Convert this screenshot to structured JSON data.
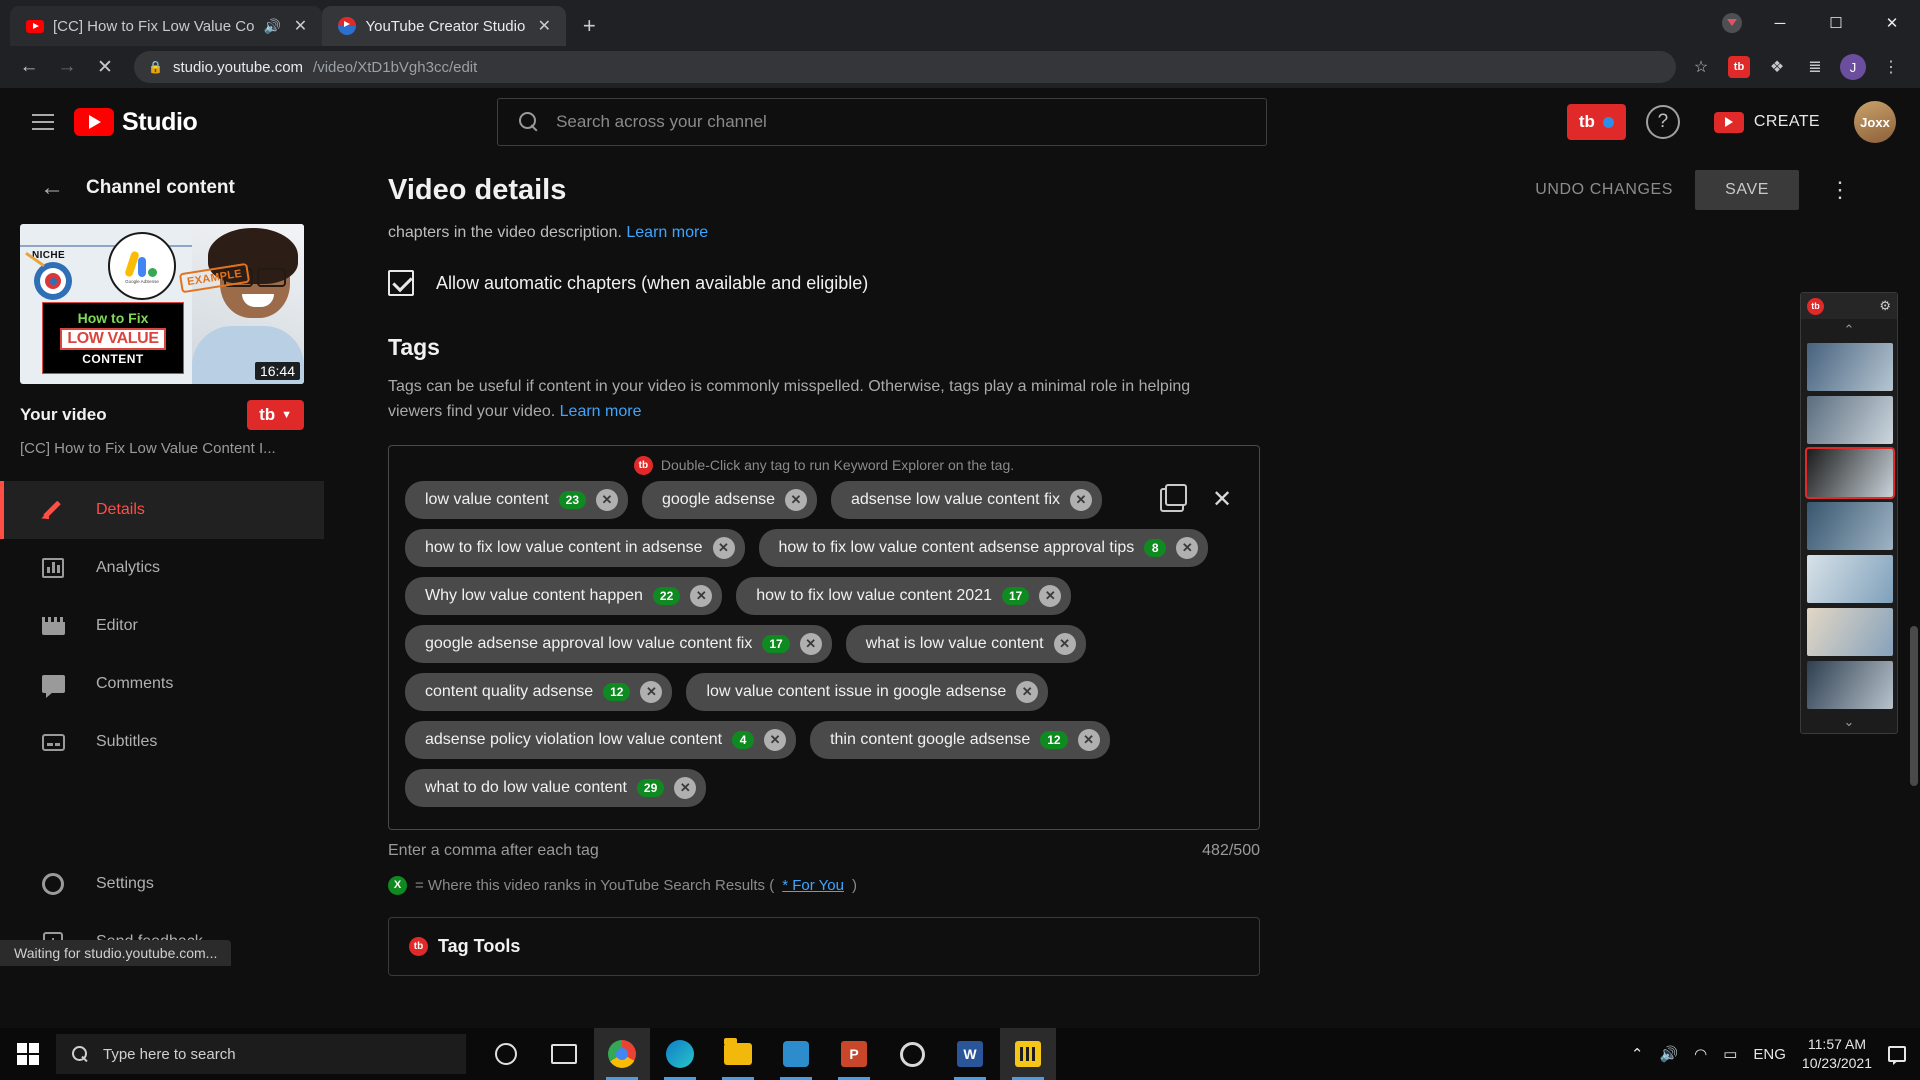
{
  "browser": {
    "tabs": [
      {
        "title": "[CC] How to Fix Low Value Co",
        "favicon": "youtube-icon",
        "muted": true,
        "active": false
      },
      {
        "title": "YouTube Creator Studio",
        "favicon": "tubebuddy-icon",
        "muted": false,
        "active": true
      }
    ],
    "newtab_label": "+",
    "url_domain": "studio.youtube.com",
    "url_path": "/video/XtD1bVgh3cc/edit",
    "back_label": "←",
    "forward_label": "→",
    "stop_label": "✕",
    "star_label": "☆",
    "tubebuddy_label": "tb",
    "extensions_label": "❖",
    "readinglist_label": "≣",
    "profile_initial": "J",
    "menu_label": "⋮",
    "minimize_label": "─",
    "maximize_label": "☐",
    "close_label": "✕"
  },
  "studio": {
    "logo_text": "Studio",
    "search_placeholder": "Search across your channel",
    "search_value": "",
    "tubebuddy_badge": "tb",
    "help_label": "?",
    "create_label": "CREATE",
    "avatar_initials": "Joxx"
  },
  "sidebar": {
    "back_label": "←",
    "title": "Channel content",
    "thumbnail": {
      "niche_label": "NICHE",
      "adsense_label": "Google AdSense",
      "example_stamp": "EXAMPLE",
      "line1": "How to Fix",
      "line2": "LOW VALUE",
      "line3": "CONTENT",
      "duration": "16:44"
    },
    "your_video_label": "Your video",
    "tubebuddy_pill": "tb",
    "video_title": "[CC] How to Fix Low Value Content I...",
    "items": [
      {
        "label": "Details",
        "icon": "pencil-icon",
        "active": true
      },
      {
        "label": "Analytics",
        "icon": "bar-chart-icon",
        "active": false
      },
      {
        "label": "Editor",
        "icon": "film-icon",
        "active": false
      },
      {
        "label": "Comments",
        "icon": "comment-icon",
        "active": false
      },
      {
        "label": "Subtitles",
        "icon": "subtitles-icon",
        "active": false
      }
    ],
    "bottom_items": [
      {
        "label": "Settings",
        "icon": "gear-icon"
      },
      {
        "label": "Send feedback",
        "icon": "feedback-icon"
      }
    ]
  },
  "main": {
    "page_title": "Video details",
    "undo_label": "UNDO CHANGES",
    "save_label": "SAVE",
    "more_label": "⋮",
    "chapters_cut_text": "chapters in the video description.",
    "chapters_learn_more": "Learn more",
    "auto_chapters_label": "Allow automatic chapters (when available and eligible)",
    "auto_chapters_checked": true,
    "tags_heading": "Tags",
    "tags_description": "Tags can be useful if content in your video is commonly misspelled. Otherwise, tags play a minimal role in helping viewers find your video.",
    "tags_learn_more": "Learn more",
    "tagbox_hint": "Double-Click any tag to run Keyword Explorer on the tag.",
    "tagbox_hint_badge": "tb",
    "copy_icon_label": "copy",
    "close_icon_label": "✕",
    "tags": [
      {
        "label": "low value content",
        "count": "23"
      },
      {
        "label": "google adsense",
        "count": null
      },
      {
        "label": "adsense low value content fix",
        "count": null
      },
      {
        "label": "how to fix low value content in adsense",
        "count": null
      },
      {
        "label": "how to fix low value content adsense approval tips",
        "count": "8"
      },
      {
        "label": "Why low value content happen",
        "count": "22"
      },
      {
        "label": "how to fix low value content 2021",
        "count": "17"
      },
      {
        "label": "google adsense approval low value content fix",
        "count": "17"
      },
      {
        "label": "what is low value content",
        "count": null
      },
      {
        "label": "content quality adsense",
        "count": "12"
      },
      {
        "label": "low value content issue in google adsense",
        "count": null
      },
      {
        "label": "adsense policy violation low value content",
        "count": "4"
      },
      {
        "label": "thin content google adsense",
        "count": "12"
      },
      {
        "label": "what to do low value content",
        "count": "29"
      }
    ],
    "tags_hint": "Enter a comma after each tag",
    "tags_counter": "482/500",
    "legend_badge": "X",
    "legend_text": "= Where this video ranks in YouTube Search Results (",
    "legend_link": "* For You",
    "legend_close": ")",
    "tag_tools_title": "Tag Tools",
    "tag_tools_badge": "tb"
  },
  "rightpanel": {
    "badge": "tb",
    "gear": "⚙",
    "up_arrow": "⌃",
    "down_arrow": "⌄",
    "thumbs": [
      {
        "selected": false
      },
      {
        "selected": false
      },
      {
        "selected": true
      },
      {
        "selected": false
      },
      {
        "selected": false
      },
      {
        "selected": false
      },
      {
        "selected": false
      }
    ]
  },
  "statusbar": {
    "text": "Waiting for studio.youtube.com..."
  },
  "taskbar": {
    "search_placeholder": "Type here to search",
    "items": [
      {
        "icon": "cortana-icon",
        "open": false,
        "highlight": false
      },
      {
        "icon": "task-view-icon",
        "open": false,
        "highlight": false
      },
      {
        "icon": "chrome-icon",
        "open": true,
        "highlight": true
      },
      {
        "icon": "edge-icon",
        "open": true,
        "highlight": false
      },
      {
        "icon": "file-explorer-icon",
        "open": true,
        "highlight": false
      },
      {
        "icon": "store-icon",
        "open": true,
        "highlight": false
      },
      {
        "icon": "powerpoint-icon",
        "open": true,
        "highlight": false
      },
      {
        "icon": "settings-icon",
        "open": false,
        "highlight": false
      },
      {
        "icon": "word-icon",
        "open": true,
        "highlight": false
      },
      {
        "icon": "tubebuddy-app-icon",
        "open": true,
        "highlight": true
      }
    ],
    "tray": {
      "chevron": "⌃",
      "volume": "🔊",
      "wifi": "◠",
      "battery": "▭",
      "language": "ENG",
      "time": "11:57 AM",
      "date": "10/23/2021"
    }
  }
}
